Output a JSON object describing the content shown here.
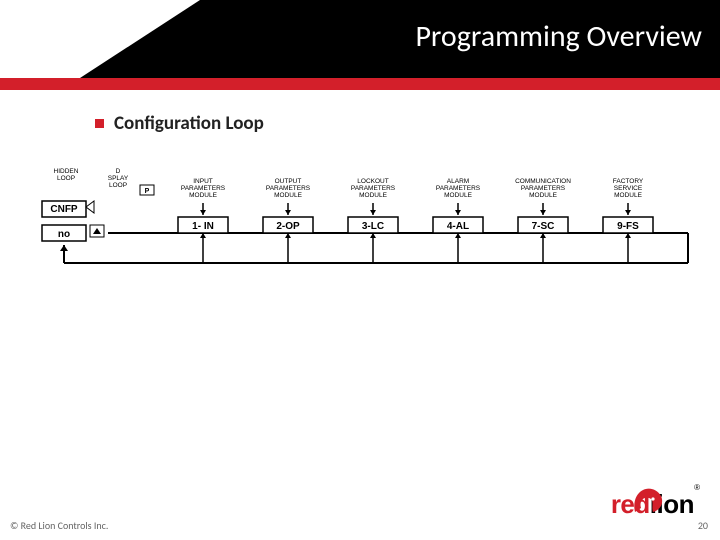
{
  "header": {
    "title": "Programming Overview"
  },
  "subtitle": "Configuration Loop",
  "diagram": {
    "left_labels": {
      "hidden": "HIDDEN LOOP",
      "display": "D SPLAY LOOP"
    },
    "left_button": "P",
    "left_icons": {
      "top_display": "CNFP",
      "bottom_display": "no"
    },
    "modules": [
      {
        "label": "INPUT PARAMETERS MODULE",
        "code": "1- IN"
      },
      {
        "label": "OUTPUT PARAMETERS MODULE",
        "code": "2-OP"
      },
      {
        "label": "LOCKOUT PARAMETERS MODULE",
        "code": "3-LC"
      },
      {
        "label": "ALARM PARAMETERS MODULE",
        "code": "4-AL"
      },
      {
        "label": "COMMUNICATION PARAMETERS MODULE",
        "code": "7-SC"
      },
      {
        "label": "FACTORY SERVICE MODULE",
        "code": "9-FS"
      }
    ]
  },
  "footer": {
    "copyright": "© Red Lion Controls Inc.",
    "page": "20",
    "logo_red": "red",
    "logo_black": "lion",
    "logo_reg": "®"
  }
}
